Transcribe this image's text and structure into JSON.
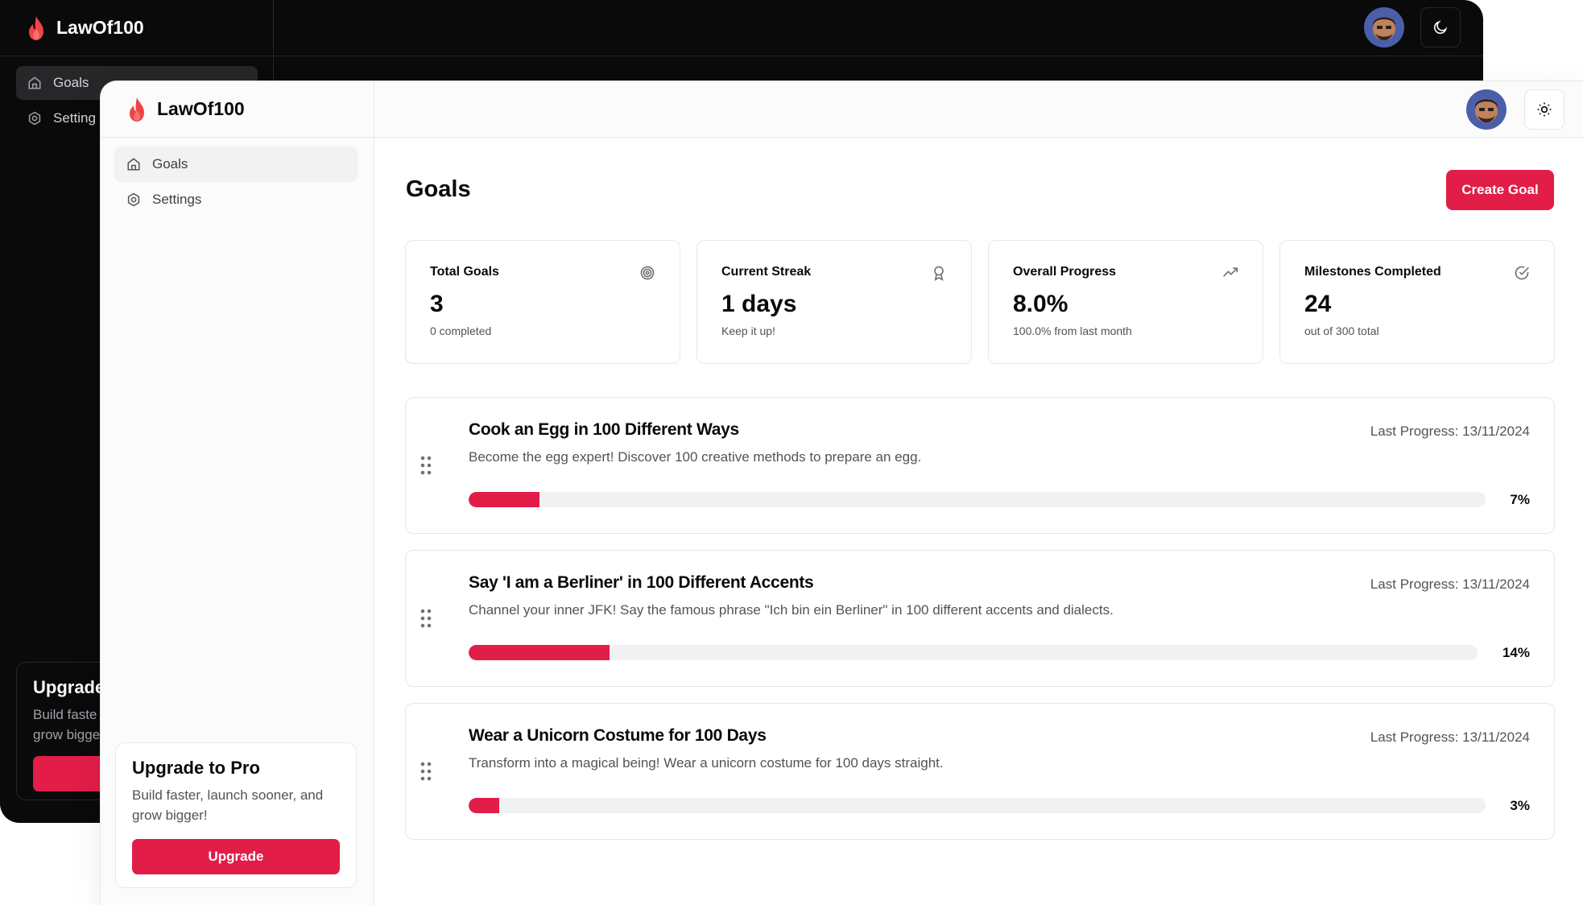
{
  "colors": {
    "accent": "#e11d48",
    "dark_bg": "#0a0a0b",
    "light_bg": "#ffffff"
  },
  "brand": {
    "name": "LawOf100",
    "logo_icon": "flame-icon"
  },
  "dark_window": {
    "nav": [
      {
        "label": "Goals",
        "icon": "home-icon",
        "active": true
      },
      {
        "label": "Setting",
        "icon": "gear-icon",
        "active": false
      }
    ],
    "upgrade": {
      "title": "Upgrade",
      "desc_line1": "Build faste",
      "desc_line2": "grow bigge"
    },
    "theme_icon": "moon-icon"
  },
  "sidebar": {
    "nav": [
      {
        "label": "Goals",
        "icon": "home-icon",
        "active": true
      },
      {
        "label": "Settings",
        "icon": "gear-icon",
        "active": false
      }
    ],
    "upgrade": {
      "title": "Upgrade to Pro",
      "description": "Build faster, launch sooner, and grow bigger!",
      "button_label": "Upgrade"
    }
  },
  "header": {
    "theme_icon": "sun-icon"
  },
  "main": {
    "title": "Goals",
    "create_button_label": "Create Goal",
    "stats": [
      {
        "label": "Total Goals",
        "value": "3",
        "sub": "0 completed",
        "icon": "target-icon"
      },
      {
        "label": "Current Streak",
        "value": "1 days",
        "sub": "Keep it up!",
        "icon": "award-icon"
      },
      {
        "label": "Overall Progress",
        "value": "8.0%",
        "sub": "100.0% from last month",
        "icon": "trending-up-icon"
      },
      {
        "label": "Milestones Completed",
        "value": "24",
        "sub": "out of 300 total",
        "icon": "check-circle-icon"
      }
    ],
    "goals": [
      {
        "title": "Cook an Egg in 100 Different Ways",
        "description": "Become the egg expert! Discover 100 creative methods to prepare an egg.",
        "last_progress": "Last Progress: 13/11/2024",
        "progress": 7,
        "progress_label": "7%"
      },
      {
        "title": "Say 'I am a Berliner' in 100 Different Accents",
        "description": "Channel your inner JFK! Say the famous phrase \"Ich bin ein Berliner\" in 100 different accents and dialects.",
        "last_progress": "Last Progress: 13/11/2024",
        "progress": 14,
        "progress_label": "14%"
      },
      {
        "title": "Wear a Unicorn Costume for 100 Days",
        "description": "Transform into a magical being! Wear a unicorn costume for 100 days straight.",
        "last_progress": "Last Progress: 13/11/2024",
        "progress": 3,
        "progress_label": "3%"
      }
    ]
  }
}
